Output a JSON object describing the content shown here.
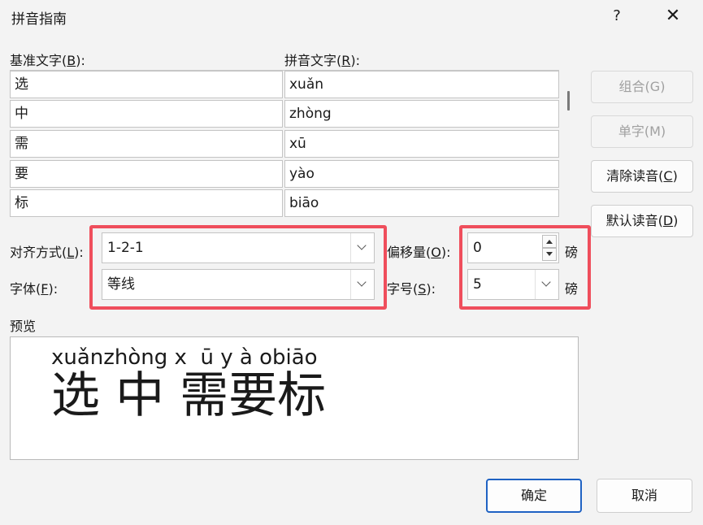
{
  "dialog": {
    "title": "拼音指南",
    "help_label": "?",
    "close_label": "✕"
  },
  "labels": {
    "base_text": {
      "text": "基准文字(",
      "key": "B",
      "tail": "):"
    },
    "ruby_text": {
      "text": "拼音文字(",
      "key": "R",
      "tail": "):"
    },
    "alignment": {
      "text": "对齐方式(",
      "key": "L",
      "tail": "):"
    },
    "font": {
      "text": "字体(",
      "key": "F",
      "tail": "):"
    },
    "offset": {
      "text": "偏移量(",
      "key": "O",
      "tail": "):"
    },
    "size": {
      "text": "字号(",
      "key": "S",
      "tail": "):"
    },
    "preview": "预览",
    "unit_offset": "磅",
    "unit_size": "磅"
  },
  "rows": [
    {
      "base": "选",
      "ruby": "xuǎn"
    },
    {
      "base": "中",
      "ruby": "zhòng"
    },
    {
      "base": "需",
      "ruby": "xū"
    },
    {
      "base": "要",
      "ruby": "yào"
    },
    {
      "base": "标",
      "ruby": "biāo"
    }
  ],
  "buttons": {
    "group": "组合(G)",
    "mono": "单字(M)",
    "clear": {
      "text": "清除读音(",
      "key": "C",
      "tail": ")"
    },
    "default": {
      "text": "默认读音(",
      "key": "D",
      "tail": ")"
    },
    "ok": "确定",
    "cancel": "取消"
  },
  "fields": {
    "alignment": "1-2-1",
    "font": "等线",
    "offset": "0",
    "size": "5"
  },
  "preview": {
    "ruby": "xuǎnzhòng x  ū y à obiāo",
    "base": "选 中 需要标"
  },
  "colors": {
    "highlight": "#ef4e5c",
    "ok_border": "#1f62c3"
  }
}
